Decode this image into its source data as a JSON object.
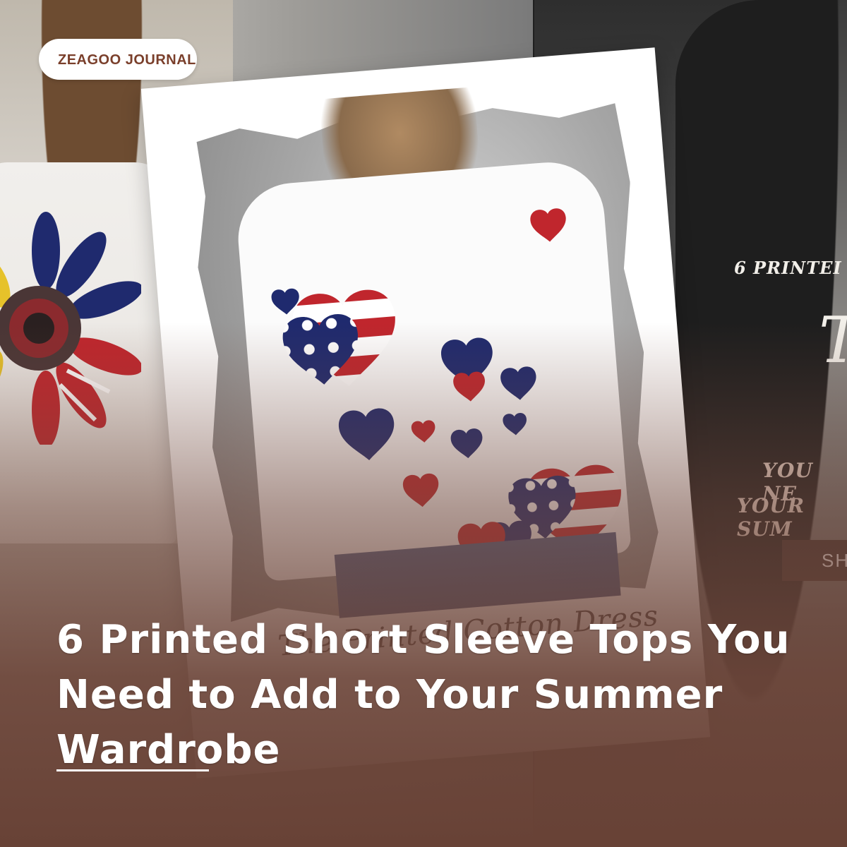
{
  "badge": {
    "label": "ZEAGOO JOURNAL"
  },
  "headline": {
    "line1": "6 Printed Short Sleeve Tops You",
    "line2": "Need to Add to Your Summer",
    "line3": "Wardrobe"
  },
  "card": {
    "caption": "The Printed Cotton Dress"
  },
  "right_panel": {
    "text1": "6 PRINTEI",
    "text2": "T",
    "text3": "YOU NE",
    "text4": "YOUR SUM",
    "button": "SH"
  },
  "colors": {
    "badge_text": "#7a3f2b",
    "overlay_bottom": "#684236",
    "heart_navy": "#1f2a6e",
    "heart_red": "#c0262d"
  }
}
